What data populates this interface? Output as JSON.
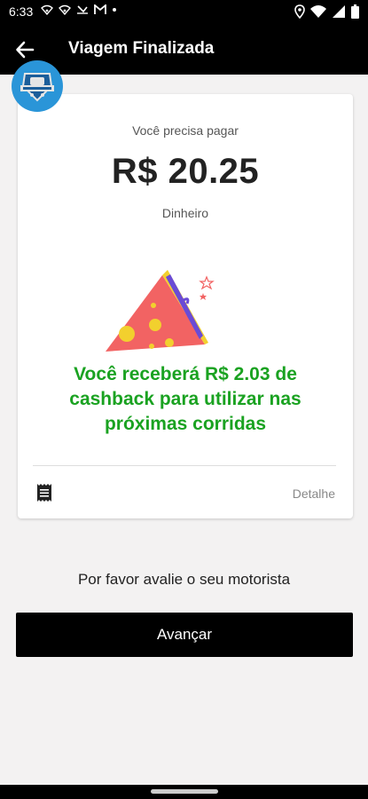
{
  "status_bar": {
    "time": "6:33",
    "left_icons": [
      "wifi-alt-icon",
      "wifi-alt-icon",
      "missed-call-icon",
      "gmail-icon",
      "dot-icon"
    ],
    "right_icons": [
      "location-icon",
      "wifi-icon",
      "signal-icon",
      "battery-icon"
    ]
  },
  "app_bar": {
    "title": "Viagem Finalizada",
    "back_icon": "arrow-back-icon"
  },
  "card": {
    "pay_label": "Você precisa pagar",
    "amount": "R$ 20.25",
    "payment_method": "Dinheiro",
    "cashback_message": "Você receberá R$ 2.03 de cashback para utilizar nas próximas corridas",
    "detail_label": "Detalhe"
  },
  "rate_prompt": "Por favor avalie o seu motorista",
  "advance_button": "Avançar",
  "colors": {
    "accent_green": "#1aa221",
    "bar": "#000000",
    "logo_blue": "#2a95d8"
  }
}
